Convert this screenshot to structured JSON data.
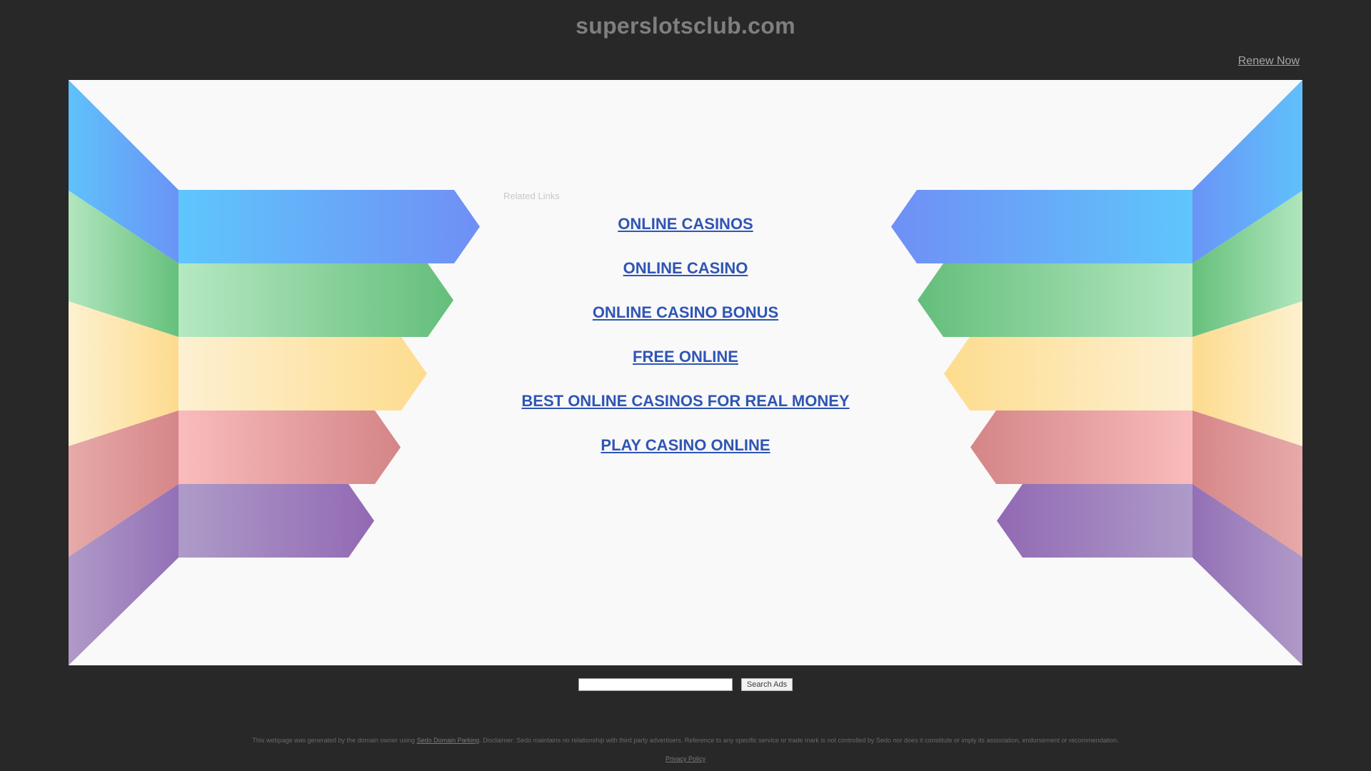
{
  "site": {
    "domain": "superslotsclub.com",
    "renew_label": "Renew Now"
  },
  "related": {
    "label": "Related Links",
    "links": [
      {
        "label": "ONLINE CASINOS"
      },
      {
        "label": "ONLINE CASINO"
      },
      {
        "label": "ONLINE CASINO BONUS"
      },
      {
        "label": "FREE ONLINE"
      },
      {
        "label": "BEST ONLINE CASINOS FOR REAL MONEY"
      },
      {
        "label": "PLAY CASINO ONLINE"
      }
    ]
  },
  "search": {
    "placeholder": "",
    "button_label": "Search Ads"
  },
  "footer": {
    "disclaimer_prefix": "This webpage was generated by the domain owner using",
    "sedo_link": "Sedo Domain Parking",
    "disclaimer_suffix": ". Disclaimer: Sedo maintains no relationship with third party advertisers. Reference to any specific service or trade mark is not controlled by Sedo nor does it constitute or imply its association, endorsement or recommendation.",
    "privacy_label": "Privacy Policy"
  },
  "colors": {
    "background": "#282828",
    "panel": "#f9f9f9",
    "link": "#2f55b5",
    "band_blue": "#5fb8fb",
    "band_green": "#6cc384",
    "band_yellow": "#fde39d",
    "band_red": "#e0999a",
    "band_purple": "#9a74b8"
  }
}
